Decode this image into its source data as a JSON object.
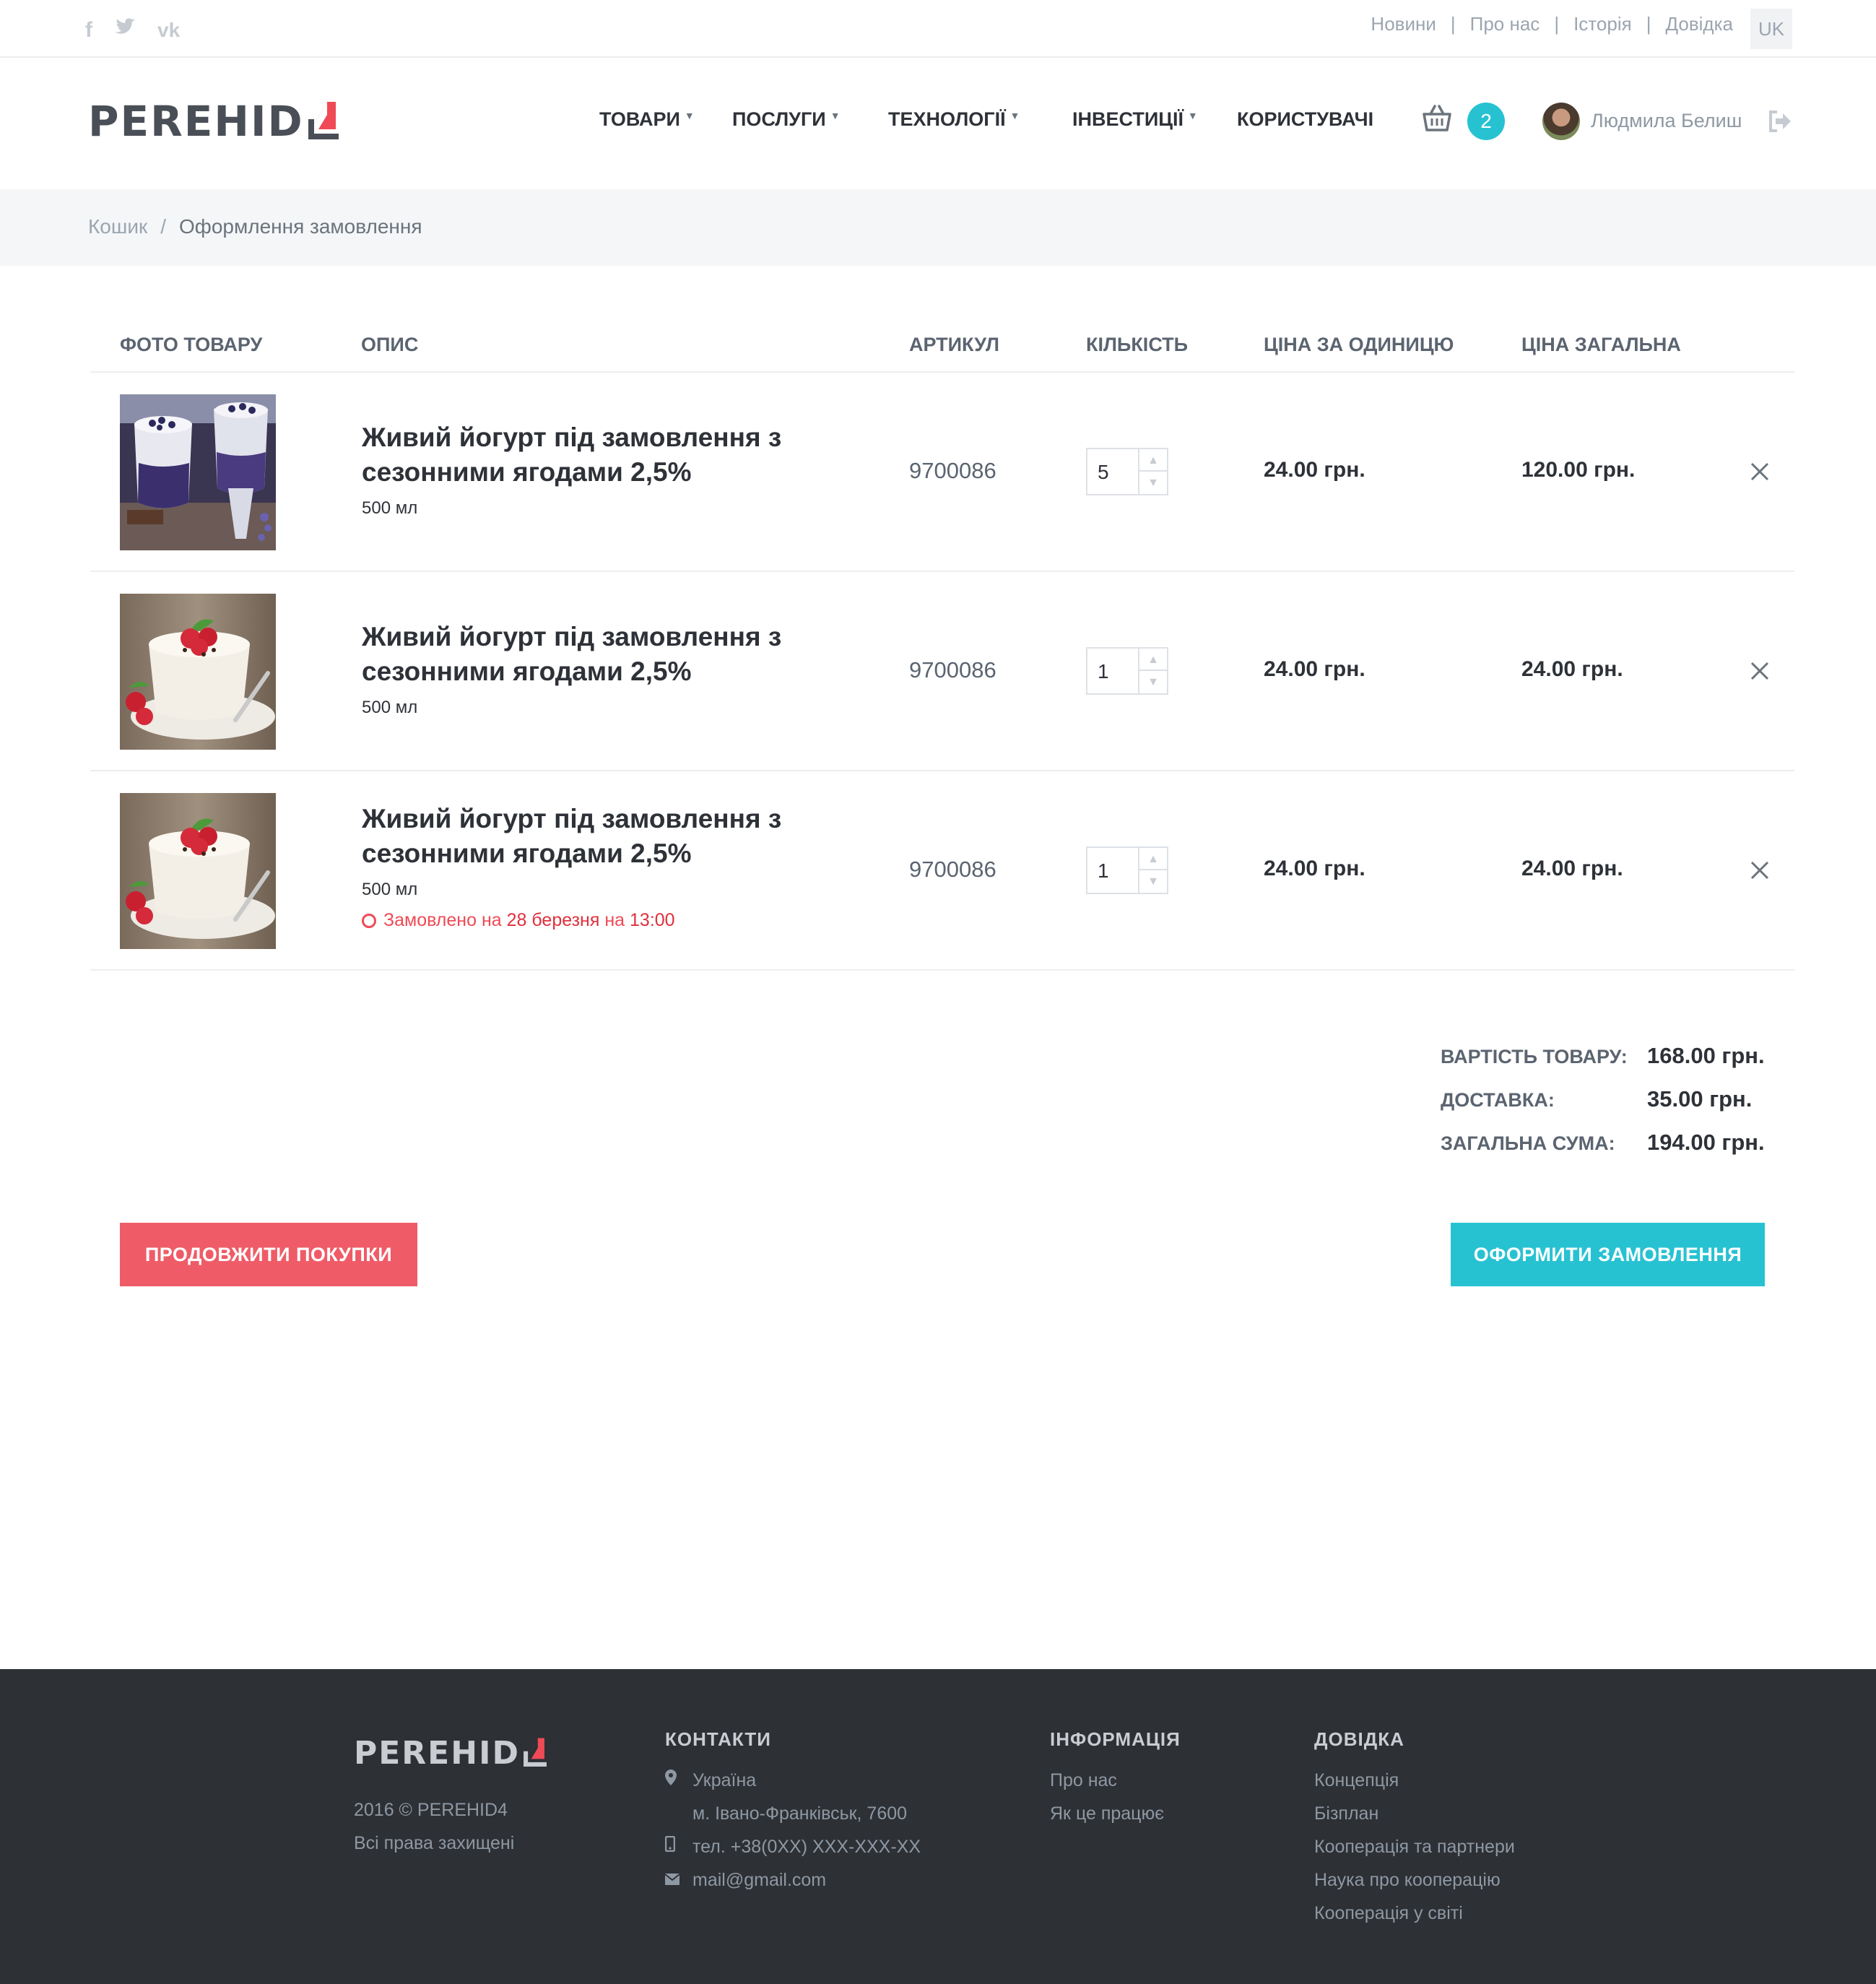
{
  "social": {
    "facebook_icon": "facebook-icon",
    "twitter_icon": "twitter-icon",
    "vk_icon": "vk-icon",
    "facebook_glyph": "f",
    "twitter_glyph": "🐦",
    "vk_glyph": "vk"
  },
  "toplinks": [
    "Новини",
    "Про нас",
    "Історія",
    "Довідка"
  ],
  "toplink_separator": "|",
  "language": "UK",
  "brand": {
    "name": "PEREHID",
    "mark_colors": {
      "red": "#ef4a55",
      "dark": "#4a4f57"
    }
  },
  "nav": {
    "items": [
      "ТОВАРИ",
      "ПОСЛУГИ",
      "ТЕХНОЛОГІЇ",
      "ІНВЕСТИЦІЇ",
      "КОРИСТУВАЧІ"
    ],
    "caret": "▼"
  },
  "cart": {
    "icon": "basket-icon",
    "count": "2"
  },
  "user": {
    "name": "Людмила Белиш",
    "logout_icon": "logout-icon"
  },
  "breadcrumb": {
    "parent": "Кошик",
    "separator": "/",
    "current": "Оформлення замовлення"
  },
  "table": {
    "headers": {
      "photo": "ФОТО ТОВАРУ",
      "description": "ОПИС",
      "sku": "АРТИКУЛ",
      "quantity": "КІЛЬКІСТЬ",
      "unit_price": "ЦІНА ЗА ОДИНИЦЮ",
      "total_price": "ЦІНА ЗАГАЛЬНА"
    },
    "rows": [
      {
        "name_line1": "Живий йогурт під замовлення з",
        "name_line2": "сезонними ягодами 2,5%",
        "volume": "500 мл",
        "sku": "9700086",
        "qty": "5",
        "unit_price": "24.00 грн.",
        "total": "120.00 грн.",
        "image": "blueberry-yogurt-photo"
      },
      {
        "name_line1": "Живий йогурт під замовлення з",
        "name_line2": "сезонними ягодами 2,5%",
        "volume": "500 мл",
        "sku": "9700086",
        "qty": "1",
        "unit_price": "24.00 грн.",
        "total": "24.00 грн.",
        "image": "raspberry-yogurt-photo"
      },
      {
        "name_line1": "Живий йогурт під замовлення з",
        "name_line2": "сезонними ягодами 2,5%",
        "volume": "500 мл",
        "note_prefix": "Замовлено на",
        "note_date": "28 березня",
        "note_mid": "на",
        "note_time": "13:00",
        "sku": "9700086",
        "qty": "1",
        "unit_price": "24.00 грн.",
        "total": "24.00 грн.",
        "image": "raspberry-yogurt-photo"
      }
    ],
    "spin_up": "▲",
    "spin_down": "▼"
  },
  "totals": {
    "goods_label": "ВАРТІСТЬ ТОВАРУ:",
    "goods_value": "168.00 грн.",
    "delivery_label": "ДОСТАВКА:",
    "delivery_value": "35.00 грн.",
    "sum_label": "ЗАГАЛЬНА СУМА:",
    "sum_value": "194.00 грн."
  },
  "buttons": {
    "continue": "ПРОДОВЖИТИ ПОКУПКИ",
    "order": "ОФОРМИТИ ЗАМОВЛЕННЯ"
  },
  "colors": {
    "accent_teal": "#27c2d2",
    "accent_red": "#ef5c67",
    "footer_bg": "#2d3035"
  },
  "footer": {
    "copyright": "2016 © PEREHID4",
    "rights": "Всі права захищені",
    "contacts": {
      "title": "КОНТАКТИ",
      "country": "Україна",
      "city": "м. Івано-Франківськ, 7600",
      "phone": "тел. +38(0XX) XXX-XXX-XX",
      "email": "mail@gmail.com",
      "location_icon": "map-marker-icon",
      "phone_icon": "phone-icon",
      "mail_icon": "envelope-icon"
    },
    "info": {
      "title": "ІНФОРМАЦІЯ",
      "links": [
        "Про нас",
        "Як це працює"
      ]
    },
    "help": {
      "title": "ДОВІДКА",
      "links": [
        "Концепція",
        "Бізплан",
        "Кооперація та партнери",
        "Наука про кооперацію",
        "Кооперація у світі"
      ]
    }
  }
}
